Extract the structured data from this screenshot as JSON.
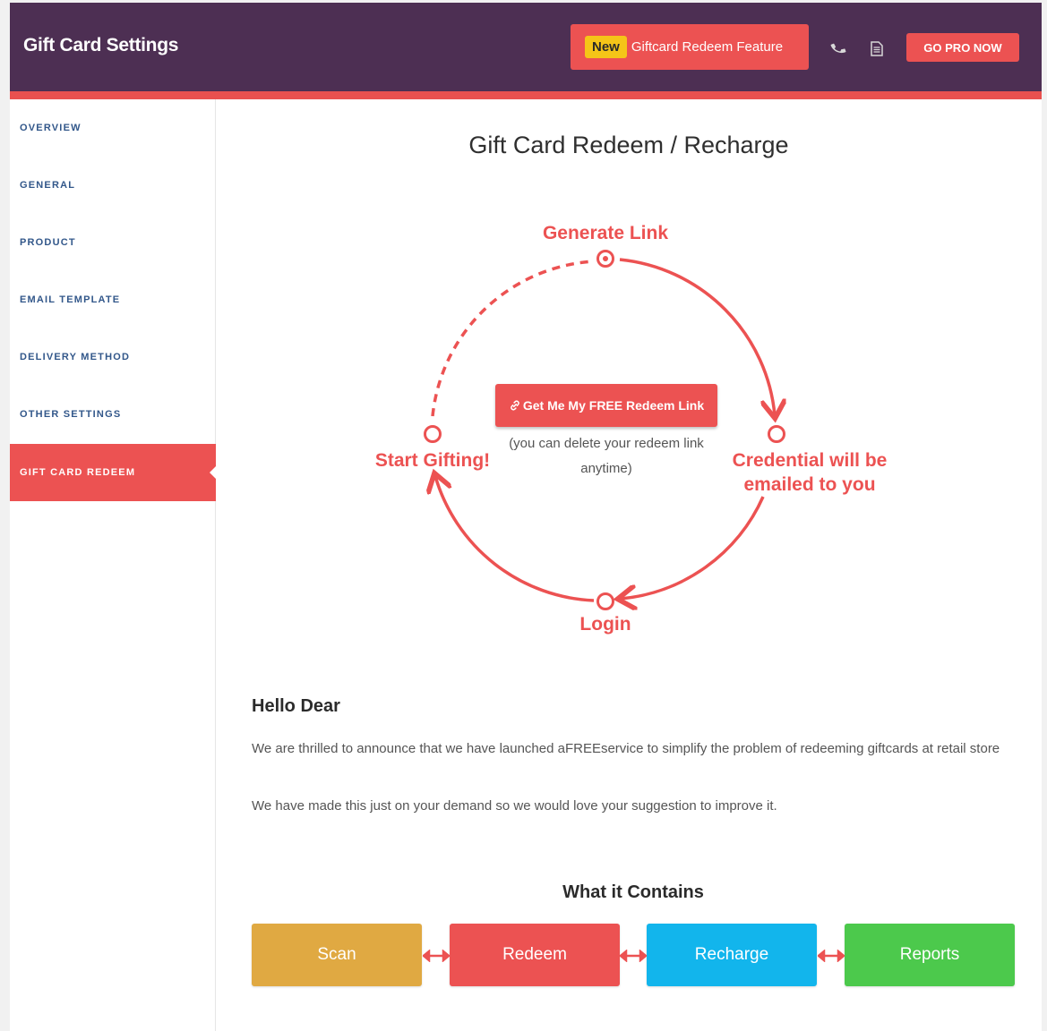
{
  "header": {
    "title": "Gift Card Settings",
    "feature_badge": "New",
    "feature_label": "Giftcard Redeem Feature",
    "phone_icon": "phone-icon",
    "doc_icon": "document-icon",
    "pro_button": "GO PRO NOW"
  },
  "sidebar": {
    "items": [
      {
        "label": "OVERVIEW",
        "active": false
      },
      {
        "label": "GENERAL",
        "active": false
      },
      {
        "label": "PRODUCT",
        "active": false
      },
      {
        "label": "EMAIL TEMPLATE",
        "active": false
      },
      {
        "label": "DELIVERY METHOD",
        "active": false
      },
      {
        "label": "OTHER SETTINGS",
        "active": false
      },
      {
        "label": "GIFT CARD REDEEM",
        "active": true
      }
    ]
  },
  "main": {
    "title": "Gift Card Redeem / Recharge",
    "cycle": {
      "top": "Generate Link",
      "right_line1": "Credential will be",
      "right_line2": "emailed to you",
      "bottom": "Login",
      "left": "Start Gifting!"
    },
    "cta_button": "Get Me My FREE Redeem Link",
    "cta_icon": "link-icon",
    "cta_note": "(you can delete your redeem link anytime)",
    "greeting": "Hello Dear",
    "paragraph1": "We are thrilled to announce that we have launched aFREEservice to simplify the problem of redeeming giftcards at retail store",
    "paragraph2": "We have made this just on your demand so we would love your suggestion to improve it.",
    "contains_title": "What it Contains",
    "features": [
      {
        "label": "Scan",
        "color": "#e0a942"
      },
      {
        "label": "Redeem",
        "color": "#ec5252"
      },
      {
        "label": "Recharge",
        "color": "#12b5ec"
      },
      {
        "label": "Reports",
        "color": "#4cc94c"
      }
    ]
  },
  "colors": {
    "header_bg": "#4d2f53",
    "accent": "#ec5252",
    "nav_text": "#32578a"
  }
}
